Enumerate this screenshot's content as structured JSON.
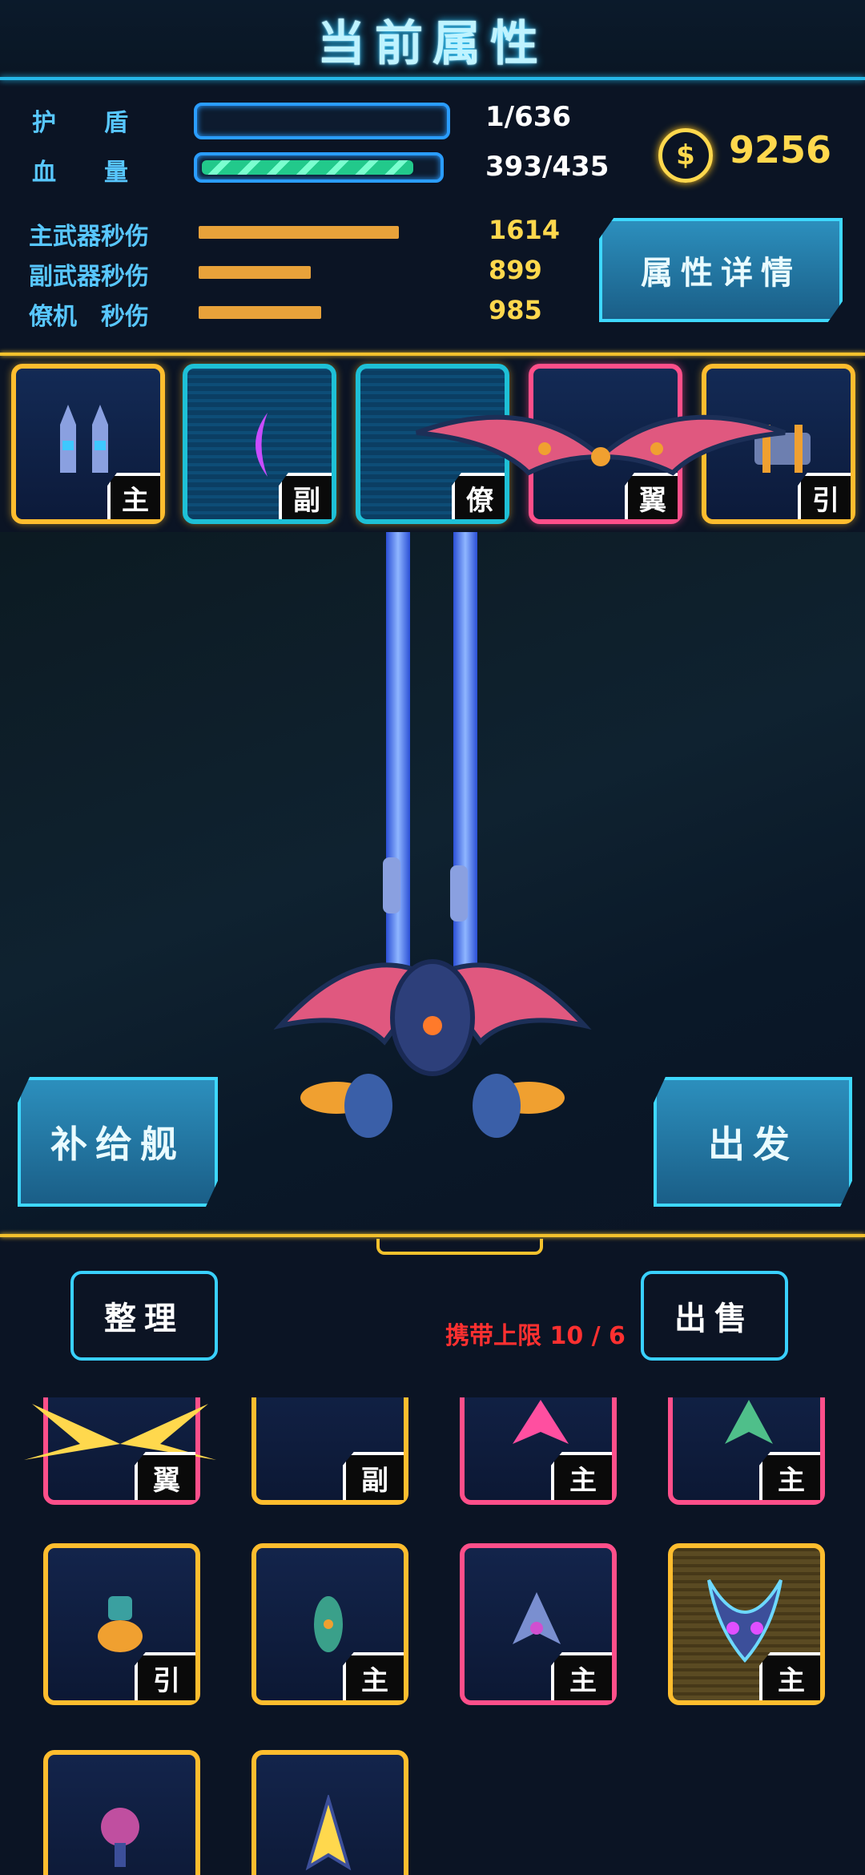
{
  "header": {
    "title": "当前属性"
  },
  "stats": {
    "shield_label": "护　　盾",
    "shield_value": "1/636",
    "hp_label": "血　　量",
    "hp_value": "393/435",
    "hp_fraction": 0.9034,
    "dps": [
      {
        "label": "主武器秒伤",
        "value": "1614",
        "fraction": 1.0
      },
      {
        "label": "副武器秒伤",
        "value": "899",
        "fraction": 0.56
      },
      {
        "label": "僚机　秒伤",
        "value": "985",
        "fraction": 0.61
      }
    ],
    "coins": "9256",
    "details_button": "属性详情"
  },
  "equipped": [
    {
      "tag": "主",
      "frame": "gold"
    },
    {
      "tag": "副",
      "frame": "cyan"
    },
    {
      "tag": "僚",
      "frame": "cyan"
    },
    {
      "tag": "翼",
      "frame": "pink"
    },
    {
      "tag": "引",
      "frame": "gold"
    }
  ],
  "actions": {
    "supply_ship": "补给舰",
    "depart": "出发"
  },
  "inventory": {
    "sort_button": "整理",
    "sell_button": "出售",
    "capacity_text": "携带上限 10 / 6",
    "items": [
      {
        "tag": "翼",
        "frame": "pink"
      },
      {
        "tag": "副",
        "frame": "gold"
      },
      {
        "tag": "主",
        "frame": "pink"
      },
      {
        "tag": "主",
        "frame": "pink"
      },
      {
        "tag": "引",
        "frame": "gold"
      },
      {
        "tag": "主",
        "frame": "gold"
      },
      {
        "tag": "主",
        "frame": "pink"
      },
      {
        "tag": "主",
        "frame": "hatch"
      },
      {
        "tag": "",
        "frame": "gold"
      },
      {
        "tag": "",
        "frame": "gold"
      }
    ]
  },
  "colors": {
    "accent_cyan": "#25b8e8",
    "gold": "#ffbd2e",
    "pink": "#ff4f8a",
    "coin_yellow": "#ffd84d"
  }
}
